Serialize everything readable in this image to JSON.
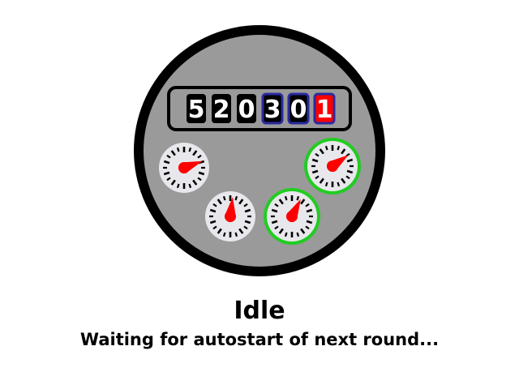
{
  "status": {
    "title": "Idle",
    "message": "Waiting for autostart of next round..."
  },
  "meter": {
    "odometer": {
      "digits": [
        {
          "value": "5",
          "style": "normal"
        },
        {
          "value": "2",
          "style": "normal"
        },
        {
          "value": "0",
          "style": "normal"
        },
        {
          "value": "3",
          "style": "decimal"
        },
        {
          "value": "0",
          "style": "decimal"
        },
        {
          "value": "1",
          "style": "active"
        }
      ]
    },
    "dials": [
      {
        "name": "dial-top-left",
        "highlighted": false,
        "pointer_direction": "west-southwest"
      },
      {
        "name": "dial-bottom-center",
        "highlighted": false,
        "pointer_direction": "south"
      },
      {
        "name": "dial-bottom-right",
        "highlighted": true,
        "pointer_direction": "southwest"
      },
      {
        "name": "dial-top-right",
        "highlighted": true,
        "pointer_direction": "southwest"
      }
    ]
  },
  "colors": {
    "meter_body": "#9a9a9a",
    "meter_rim": "#000000",
    "dial_face": "#e8e8ec",
    "dial_highlight": "#22cc22",
    "pointer": "#ff0000",
    "digit_normal_bg": "#000000",
    "digit_decimal_border": "#2a2aa0",
    "digit_active_bg": "#ff0000"
  }
}
